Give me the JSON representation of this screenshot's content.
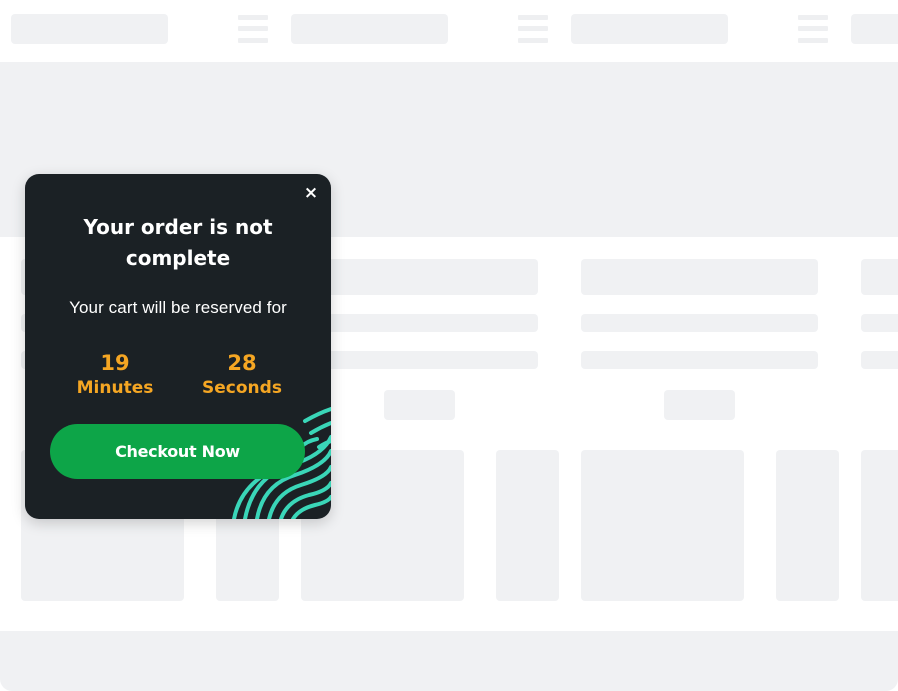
{
  "popup": {
    "close_icon": "×",
    "title": "Your order is not complete",
    "subtitle": "Your cart will be reserved for",
    "timer": {
      "minutes": "19",
      "minutes_label": "Minutes",
      "seconds": "28",
      "seconds_label": "Seconds"
    },
    "checkout_label": "Checkout Now"
  },
  "colors": {
    "popup_bg": "#1b2125",
    "accent": "#f5a623",
    "button": "#0da548",
    "pattern": "#3ad6b8",
    "placeholder": "#f0f1f3"
  },
  "icons": [
    "close-icon",
    "hamburger-icon",
    "fingerprint-pattern"
  ]
}
